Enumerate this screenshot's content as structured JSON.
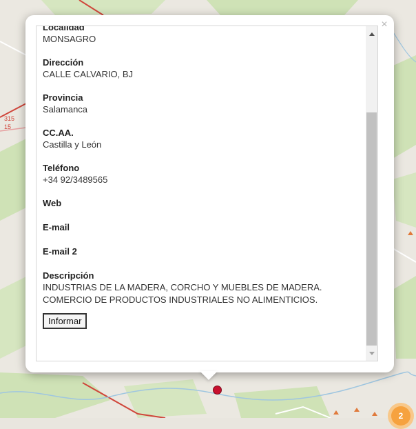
{
  "map": {
    "road_labels": [
      "315",
      "15"
    ],
    "cluster_count": "2",
    "colors": {
      "land": "#ebe8e1",
      "green": "#cfe2b6",
      "road": "#d0463b",
      "marker": "#c8102e",
      "cluster": "#f6a23f"
    }
  },
  "popup": {
    "close_icon": "×",
    "fields": [
      {
        "label": "Localidad",
        "value": "MONSAGRO"
      },
      {
        "label": "Dirección",
        "value": "CALLE CALVARIO, BJ"
      },
      {
        "label": "Provincia",
        "value": "Salamanca"
      },
      {
        "label": "CC.AA.",
        "value": "Castilla y León"
      },
      {
        "label": "Teléfono",
        "value": "+34 92/3489565"
      },
      {
        "label": "Web",
        "value": ""
      },
      {
        "label": "E-mail",
        "value": ""
      },
      {
        "label": "E-mail 2",
        "value": ""
      },
      {
        "label": "Descripción",
        "value": "INDUSTRIAS DE LA MADERA, CORCHO Y MUEBLES DE MADERA. COMERCIO DE PRODUCTOS INDUSTRIALES NO ALIMENTICIOS."
      }
    ],
    "report_button": "Informar"
  }
}
